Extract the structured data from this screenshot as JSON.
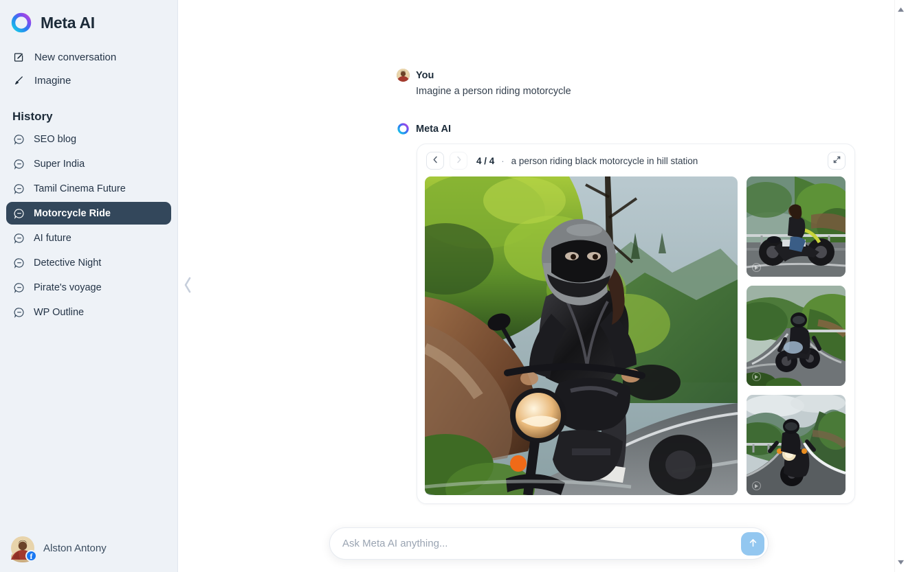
{
  "brand": {
    "title": "Meta AI",
    "logo_icon": "meta-ai-ring-logo"
  },
  "sidebar": {
    "nav": [
      {
        "label": "New conversation",
        "icon": "edit-square-icon"
      },
      {
        "label": "Imagine",
        "icon": "paintbrush-icon"
      }
    ],
    "history_heading": "History",
    "history": [
      {
        "label": "SEO blog",
        "icon": "chat-bubble-icon",
        "active": false
      },
      {
        "label": "Super India",
        "icon": "chat-bubble-icon",
        "active": false
      },
      {
        "label": "Tamil Cinema Future",
        "icon": "chat-bubble-icon",
        "active": false
      },
      {
        "label": "Motorcycle Ride",
        "icon": "chat-bubble-icon",
        "active": true
      },
      {
        "label": "AI future",
        "icon": "chat-bubble-icon",
        "active": false
      },
      {
        "label": "Detective Night",
        "icon": "chat-bubble-icon",
        "active": false
      },
      {
        "label": "Pirate's voyage",
        "icon": "chat-bubble-icon",
        "active": false
      },
      {
        "label": "WP Outline",
        "icon": "chat-bubble-icon",
        "active": false
      }
    ],
    "profile": {
      "name": "Alston Antony",
      "badge_icon": "facebook-badge-icon"
    },
    "collapse_icon": "chevron-left-icon",
    "active_bg": "#33475b",
    "bg": "#eef2f7"
  },
  "conversation": {
    "user_message": {
      "author": "You",
      "text": "Imagine a person riding motorcycle",
      "avatar_icon": "user-avatar"
    },
    "ai_message": {
      "author": "Meta AI",
      "avatar_icon": "meta-ai-ring-logo"
    }
  },
  "gallery": {
    "prev_icon": "chevron-left-icon",
    "next_icon": "chevron-right-icon",
    "counter": "4 / 4",
    "separator": "·",
    "prompt": "a person riding black motorcycle in hill station",
    "expand_icon": "expand-diagonal-icon",
    "main_image_alt": "woman in black leather jacket and helmet riding a black motorcycle on a wet hill road",
    "thumbnails": [
      {
        "alt": "woman standing beside black and yellow naked motorcycle at a hill viewpoint",
        "watermark_icon": "meta-ai-watermark-icon"
      },
      {
        "alt": "rider on black motorcycle riding through green mountain valley road",
        "watermark_icon": "meta-ai-watermark-icon"
      },
      {
        "alt": "rider on black motorcycle on winding mountain road with headlight on",
        "watermark_icon": "meta-ai-watermark-icon"
      }
    ]
  },
  "composer": {
    "value": "",
    "placeholder": "Ask Meta AI anything...",
    "send_icon": "arrow-up-icon",
    "send_color": "#93c7f0"
  },
  "scrollbar": {
    "up_icon": "triangle-up-icon",
    "down_icon": "triangle-down-icon"
  }
}
